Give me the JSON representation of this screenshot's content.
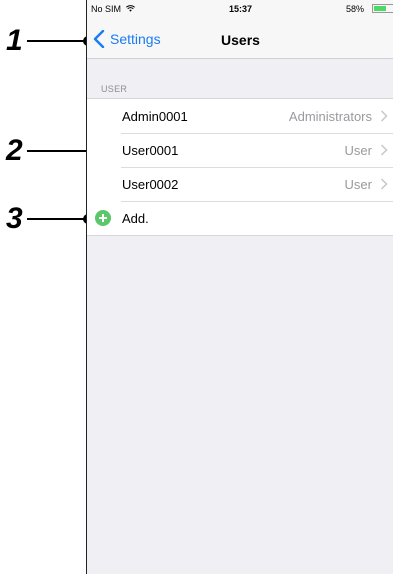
{
  "callouts": [
    "1",
    "2",
    "3"
  ],
  "status_bar": {
    "carrier": "No SIM",
    "time": "15:37",
    "battery": "58%",
    "battery_level": 0.58,
    "battery_color": "#4cd964"
  },
  "nav": {
    "back_label": "Settings",
    "title": "Users"
  },
  "section": {
    "header": "USER"
  },
  "users": [
    {
      "name": "Admin0001",
      "role": "Administrators"
    },
    {
      "name": "User0001",
      "role": "User"
    },
    {
      "name": "User0002",
      "role": "User"
    }
  ],
  "add_label": "Add.",
  "colors": {
    "accent": "#1a7cf4",
    "add_green": "#5cc66a",
    "background": "#efeff4"
  }
}
